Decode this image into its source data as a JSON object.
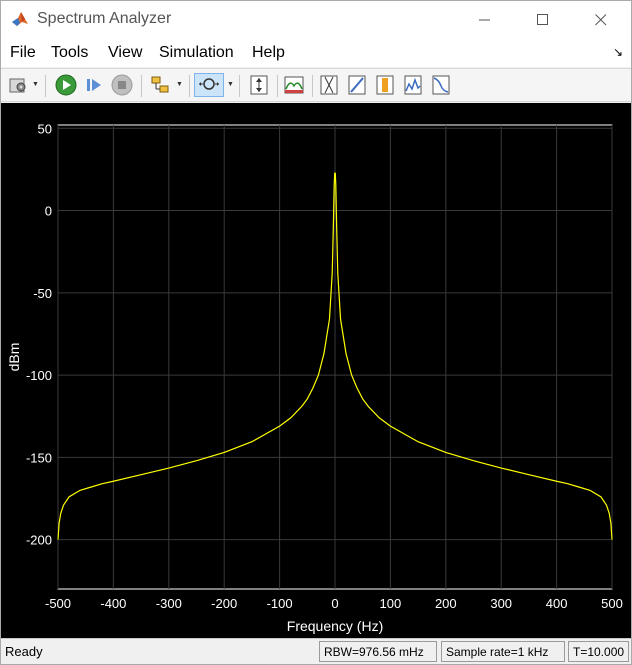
{
  "window": {
    "title": "Spectrum Analyzer"
  },
  "menu": {
    "items": [
      "File",
      "Tools",
      "View",
      "Simulation",
      "Help"
    ]
  },
  "toolbar": {
    "icons": [
      "settings-icon",
      "run-icon",
      "step-forward-icon",
      "stop-icon",
      "highlight-block-icon",
      "zoom-icon",
      "autoscale-icon",
      "spectrum-settings-icon",
      "cursor-measurements-icon",
      "signal-statistics-icon",
      "peak-finder-icon",
      "distortion-icon",
      "ccdf-icon"
    ]
  },
  "status": {
    "ready": "Ready",
    "rbw": "RBW=976.56 mHz",
    "sample_rate": "Sample rate=1 kHz",
    "time": "T=10.000"
  },
  "colors": {
    "background": "#000000",
    "trace": "#ffff00",
    "grid": "#3a3a3a",
    "axis_text": "#ffffff"
  },
  "chart_data": {
    "type": "line",
    "title": "",
    "xlabel": "Frequency (Hz)",
    "ylabel": "dBm",
    "xlim": [
      -500,
      500
    ],
    "ylim": [
      -230,
      52
    ],
    "x_ticks": [
      -500,
      -400,
      -300,
      -200,
      -100,
      0,
      100,
      200,
      300,
      400,
      500
    ],
    "y_ticks": [
      50,
      0,
      -50,
      -100,
      -150,
      -200
    ],
    "x_tick_labels": [
      "-500",
      "-400",
      "-300",
      "-200",
      "-100",
      "0",
      "100",
      "200",
      "300",
      "400",
      "500"
    ],
    "y_tick_labels": [
      "50",
      "0",
      "-50",
      "-100",
      "-150",
      "-200"
    ],
    "grid": true,
    "series": [
      {
        "color": "#ffff00",
        "x": [
          -500,
          -498,
          -495,
          -490,
          -480,
          -460,
          -440,
          -420,
          -400,
          -350,
          -300,
          -250,
          -200,
          -150,
          -100,
          -80,
          -60,
          -50,
          -40,
          -30,
          -20,
          -10,
          -5,
          -3,
          -1.5,
          -0.5,
          0,
          0.5,
          1.5,
          3,
          5,
          10,
          20,
          30,
          40,
          50,
          60,
          80,
          100,
          150,
          200,
          250,
          300,
          350,
          400,
          420,
          440,
          460,
          480,
          490,
          495,
          498,
          500
        ],
        "y": [
          -200,
          -190,
          -184,
          -179,
          -174,
          -170,
          -168,
          -166,
          -164.5,
          -160.5,
          -156.5,
          -152,
          -147,
          -140.5,
          -131,
          -126,
          -119,
          -114.5,
          -108,
          -100,
          -87,
          -66,
          -38,
          -10,
          15,
          23,
          20,
          23,
          15,
          -10,
          -38,
          -66,
          -87,
          -100,
          -108,
          -114.5,
          -119,
          -126,
          -131,
          -140.5,
          -147,
          -152,
          -156.5,
          -160.5,
          -164.5,
          -166,
          -168,
          -170,
          -174,
          -179,
          -184,
          -190,
          -200
        ]
      }
    ]
  }
}
